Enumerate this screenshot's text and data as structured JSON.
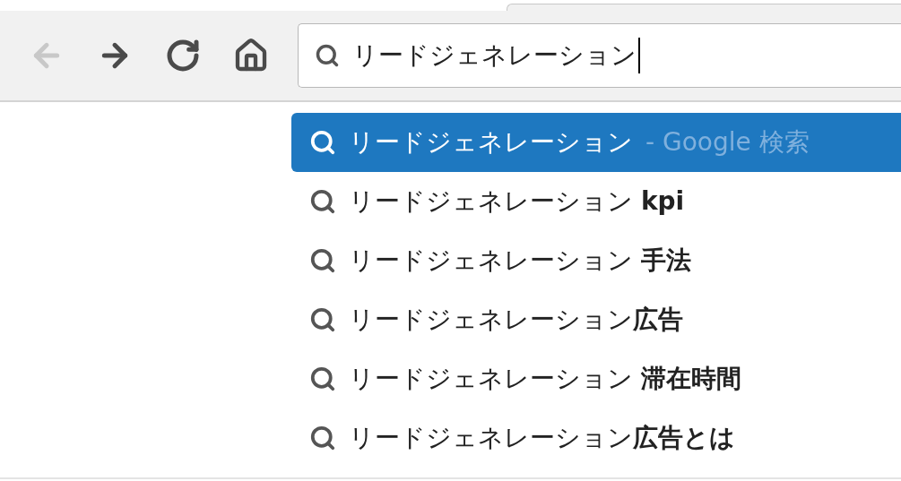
{
  "toolbar": {
    "nav_buttons": [
      {
        "kind": "back",
        "disabled": true
      },
      {
        "kind": "forward",
        "disabled": false
      },
      {
        "kind": "reload",
        "disabled": false
      },
      {
        "kind": "home",
        "disabled": false
      }
    ],
    "omnibox": {
      "value": "リードジェネレーション",
      "focused": true
    }
  },
  "suggestions": [
    {
      "text": "リードジェネレーション",
      "description": "- Google 検索",
      "selected": true
    },
    {
      "text": "リードジェネレーション **kpi**",
      "selected": false
    },
    {
      "text": "リードジェネレーション **手法**",
      "selected": false
    },
    {
      "text": "リードジェネレーション**広告**",
      "selected": false
    },
    {
      "text": "リードジェネレーション **滞在時間**",
      "selected": false
    },
    {
      "text": "リードジェネレーション**広告とは**",
      "selected": false
    }
  ]
}
